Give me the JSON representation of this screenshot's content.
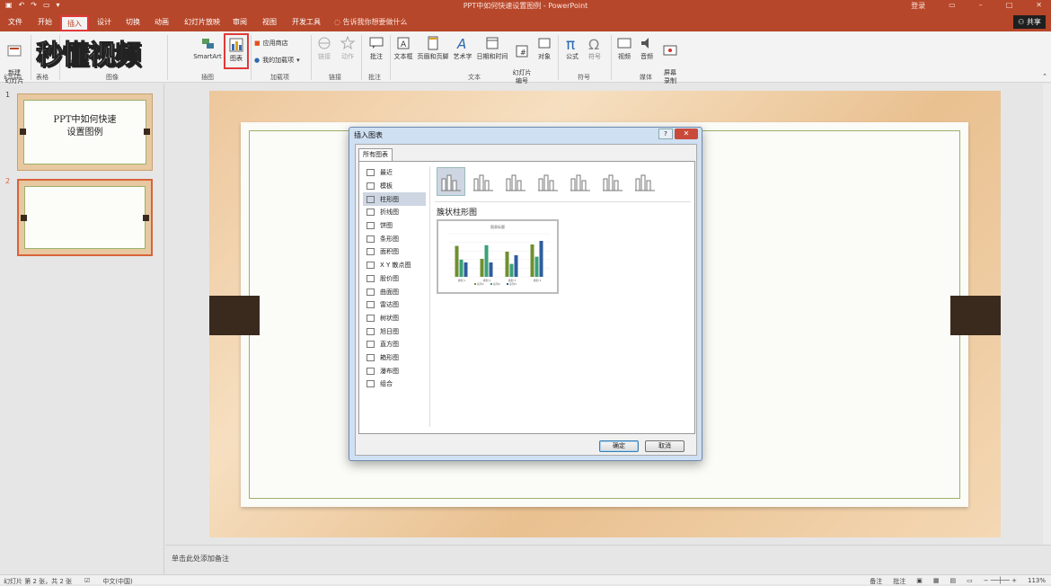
{
  "window": {
    "title": "PPT中如何快速设置图例 - PowerPoint",
    "login": "登录",
    "share": "共享",
    "tell_me": "告诉我你想要做什么"
  },
  "tabs": [
    "文件",
    "开始",
    "插入",
    "设计",
    "切换",
    "动画",
    "幻灯片放映",
    "审阅",
    "视图",
    "开发工具"
  ],
  "ribbon": {
    "new_slide": "新建\n幻灯片",
    "groups": {
      "slides": "幻灯片",
      "tables": "表格",
      "images": "图像",
      "illustrations": "插图",
      "addins": "加载项",
      "links": "链接",
      "comments": "批注",
      "text": "文本",
      "symbols": "符号",
      "media": "媒体"
    },
    "smartart": "SmartArt",
    "chart": "图表",
    "store": "应用商店",
    "my_addins": "我的加载项",
    "link": "链接",
    "action": "动作",
    "comment": "批注",
    "textbox": "文本框",
    "header_footer": "页眉和页脚",
    "wordart": "艺术字",
    "datetime": "日期和时间",
    "slide_number": "幻灯片\n编号",
    "object": "对象",
    "equation": "公式",
    "symbol": "符号",
    "video": "视频",
    "audio": "音频",
    "screen_record": "屏幕\n录制"
  },
  "watermark": "秒懂视频",
  "slides": [
    {
      "number": "1",
      "title_line1": "PPT中如何快速",
      "title_line2": "设置图例"
    },
    {
      "number": "2"
    }
  ],
  "notes_placeholder": "单击此处添加备注",
  "status": {
    "slide_info": "幻灯片 第 2 张，共 2 张",
    "language": "中文(中国)",
    "notes": "备注",
    "comments": "批注",
    "zoom": "113%"
  },
  "dialog": {
    "title": "插入图表",
    "help": "?",
    "tab": "所有图表",
    "categories": [
      "最近",
      "模板",
      "柱形图",
      "折线图",
      "饼图",
      "条形图",
      "面积图",
      "X Y 散点图",
      "股价图",
      "曲面图",
      "雷达图",
      "树状图",
      "旭日图",
      "直方图",
      "箱形图",
      "瀑布图",
      "组合"
    ],
    "selected_category": "柱形图",
    "selected_type_name": "簇状柱形图",
    "preview_title": "图表标题",
    "ok": "确定",
    "cancel": "取消"
  },
  "chart_data": {
    "type": "bar",
    "categories": [
      "类别 1",
      "类别 2",
      "类别 3",
      "类别 4"
    ],
    "series": [
      {
        "name": "系列1",
        "values": [
          4.3,
          2.5,
          3.5,
          4.5
        ]
      },
      {
        "name": "系列2",
        "values": [
          2.4,
          4.4,
          1.8,
          2.8
        ]
      },
      {
        "name": "系列3",
        "values": [
          2.0,
          2.0,
          3.0,
          5.0
        ]
      }
    ],
    "colors": [
      "#6f8f2f",
      "#3aa07a",
      "#2e5d9c"
    ],
    "ylim": [
      0,
      6
    ]
  }
}
